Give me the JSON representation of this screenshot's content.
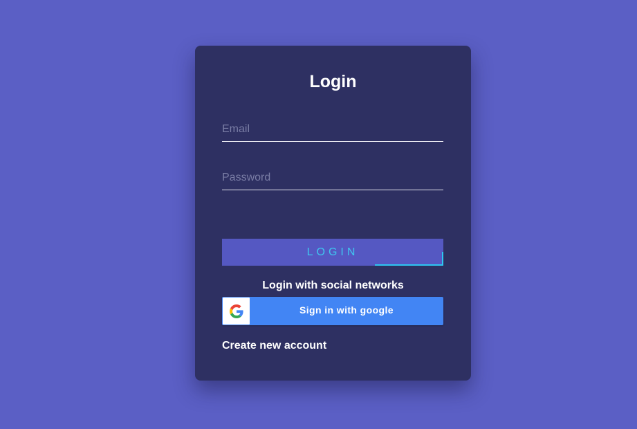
{
  "page": {
    "background_color": "#5b5fc5"
  },
  "card": {
    "background_color": "#2e3062",
    "title": "Login",
    "email": {
      "placeholder": "Email",
      "value": ""
    },
    "password": {
      "placeholder": "Password",
      "value": ""
    },
    "login_button": {
      "label": "LOGIN",
      "color": "#5558c2",
      "text_color": "#3fc6f0"
    },
    "social_label": "Login with social networks",
    "google_button": {
      "label": "Sign in with google",
      "icon": "google-g-icon",
      "color": "#4285f4"
    },
    "create_account_link": "Create new account"
  }
}
